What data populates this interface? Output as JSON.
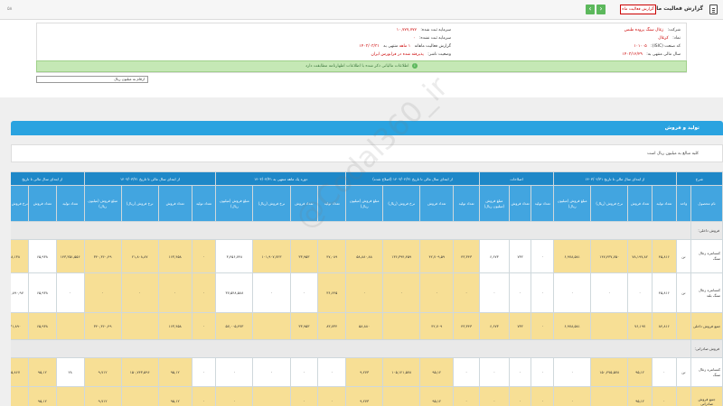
{
  "topbar": {
    "title": "گزارش فعالیت ماهانه",
    "report_button": "گزارش فعالیت ماه",
    "prev_label": "‹",
    "next_label": "›",
    "page_num": "۵۸"
  },
  "info": {
    "company_label": "شرکت:",
    "company_value": "زغال سنگ پروده طبس",
    "symbol_label": "نماد:",
    "symbol_value": "کزغال",
    "capital_label": "سرمایه ثبت شده:",
    "capital_value": "۱۰,۷۷۷,۷۷۷",
    "unreg_capital_label": "سرمایه ثبت نشده:",
    "unreg_capital_value": "۰",
    "isic_label": "کد صنعت (ISIC):",
    "isic_value": "۱۰۱۰۰۵",
    "report_type_label": "گزارش فعالیت ماهانه",
    "period_value": "۱ ماهه",
    "ending_label": "منتهی به",
    "ending_value": "۱۴۰۳/۰۳/۳۱",
    "fiscal_label": "سال مالی منتهی به:",
    "fiscal_value": "۱۴۰۳/۱۲/۲۹",
    "status_label": "وضعیت ناشر:",
    "status_value": "پذیرفته شده در فرابورس ایران"
  },
  "notice": {
    "text": "اطلاعات مالیاتی ذکر شده با اطلاعات اظهارنامه مطابقت دارد"
  },
  "filter": {
    "value": "ارقام به میلیون ریال"
  },
  "section": {
    "title": "تولید و فروش",
    "note": "کلیه مبالغ به میلیون ریال است"
  },
  "watermark": "@Codal360_ir",
  "table": {
    "group_headers": [
      "شرح",
      "از ابتدای سال مالی تا تاریخ ۱۴۰۳/۰۲/۳۱",
      "اصلاحات",
      "از ابتدای سال مالی تا تاریخ ۱۴۰۳/۰۲/۳۱ (اصلاح شده)",
      "دوره یک ماهه منتهی به ۱۴۰۳/۰۳/۳۱",
      "از ابتدای سال مالی تا تاریخ ۱۴۰۳/۰۳/۳۱",
      "از ابتدای سال مالی تا تاریخ"
    ],
    "sub_headers": [
      "نام محصول",
      "واحد",
      "تعداد تولید",
      "تعداد فروش",
      "نرخ فروش (ریال)",
      "مبلغ فروش (میلیون ریال)",
      "تعداد تولید",
      "تعداد فروش",
      "مبلغ فروش (میلیون ریال)",
      "تعداد تولید",
      "تعداد فروش",
      "نرخ فروش (ریال)",
      "مبلغ فروش (میلیون ریال)",
      "تعداد تولید",
      "تعداد فروش",
      "نرخ فروش (ریال)",
      "مبلغ فروش (میلیون ریال)",
      "تعداد تولید",
      "تعداد فروش",
      "نرخ فروش (ریال)",
      "مبلغ فروش (میلیون ریال)",
      "تعداد تولید",
      "تعداد فروش",
      "نرخ فروش (ریال)"
    ],
    "sec_domestic": "فروش داخلی:",
    "sec_export": "فروش صادراتی:",
    "row1": [
      "کنسانتره زغال سنگ",
      "تن",
      "۴۵,۸۱۶",
      "۷۸,۱۹۷,۸۲",
      "۱۴۷,۴۳۷,۷۵۰",
      "۶,۹۷۸,۵۸۱",
      "۰",
      "۷۳۲",
      "۶,۶۷۳",
      "۴۳,۳۴۳",
      "۴۲,۷۰۹,۵۹",
      "۱۳۶,۳۹۴,۴۵۹",
      "۵۸,۸۸۰,۸۸",
      "۴۷,۰۸۹",
      "۳۳,۹۵۳",
      "۱۰۱,۹۰۷,۷۲۳",
      "۳,۴۵۶,۷۴۸",
      "۰",
      "۱۶۳,۴۵۸",
      "۲۱,۸۰۸,۸۷",
      "۳۴۰,۳۶۰,۴۹",
      "۱۴۳,۳۵۱,۵۵۶",
      "۶۵,۹۳۸",
      "۱۸,۱۳۸"
    ],
    "row2": [
      "کنسانتره زغال سنگ بلند",
      "تن",
      "۴۵,۸۱۶",
      "۰",
      "۰",
      "۰",
      "۰",
      "۰",
      "۰",
      "۰",
      "۰",
      "۰",
      "۰",
      "۳۶,۶۴۵",
      "۰",
      "۰",
      "۳۷,۵۴۸,۵۸۸",
      "۰",
      "۰",
      "۰",
      "۰",
      "۰",
      "۶۵,۹۳۸",
      "۱۳۱,۸۹۰,۹۷"
    ],
    "row3": [
      "جمع فروش داخلی",
      "",
      "۸۴,۸۱۶",
      "۷۶,۱۹۷",
      "",
      "۶,۹۷۸,۵۸۱",
      "۰",
      "۷۳۲",
      "۶,۶۷۳",
      "۴۳,۳۴۳",
      "۴۲,۷۰۹",
      "",
      "۵۸,۸۸۰",
      "۸۳,۷۳۴",
      "۳۳,۹۵۳",
      "",
      "۵۷,۰۰۵,۴۷۳",
      "۰",
      "۱۶۳,۴۵۸",
      "",
      "۳۴۰,۳۶۰,۴۹",
      "",
      "۶۵,۹۳۸",
      "۱۳۱,۸۹۰"
    ],
    "row4": [
      "کنسانتره زغال سنگ",
      "تن",
      "۰",
      "۹۵,۱۲",
      "۱۵۰,۴۷۵,۵۷۸",
      "۰",
      "۰",
      "۰",
      "۰",
      "۰",
      "۹۵,۱۲",
      "۱۰۵,۱۲۱,۵۷۸",
      "۹,۲۷۳",
      "۰",
      "۰",
      "۰",
      "۰",
      "۰",
      "۹۵,۱۲",
      "۱۵۰,۷۴۳,۵۹۶",
      "۹,۷۱۲",
      "۲۸",
      "۹۵,۱۲",
      "۱۵,۸۶۷"
    ],
    "row5": [
      "جمع فروش صادراتی",
      "",
      "۰",
      "۹۵,۱۲",
      "",
      "۰",
      "۰",
      "۰",
      "۰",
      "۰",
      "۹۵,۱۲",
      "",
      "۹,۲۷۳",
      "۰",
      "۰",
      "",
      "۰",
      "۰",
      "۹۵,۱۲",
      "",
      "۹,۷۱۲",
      "",
      "۹۵,۱۲",
      ""
    ]
  }
}
